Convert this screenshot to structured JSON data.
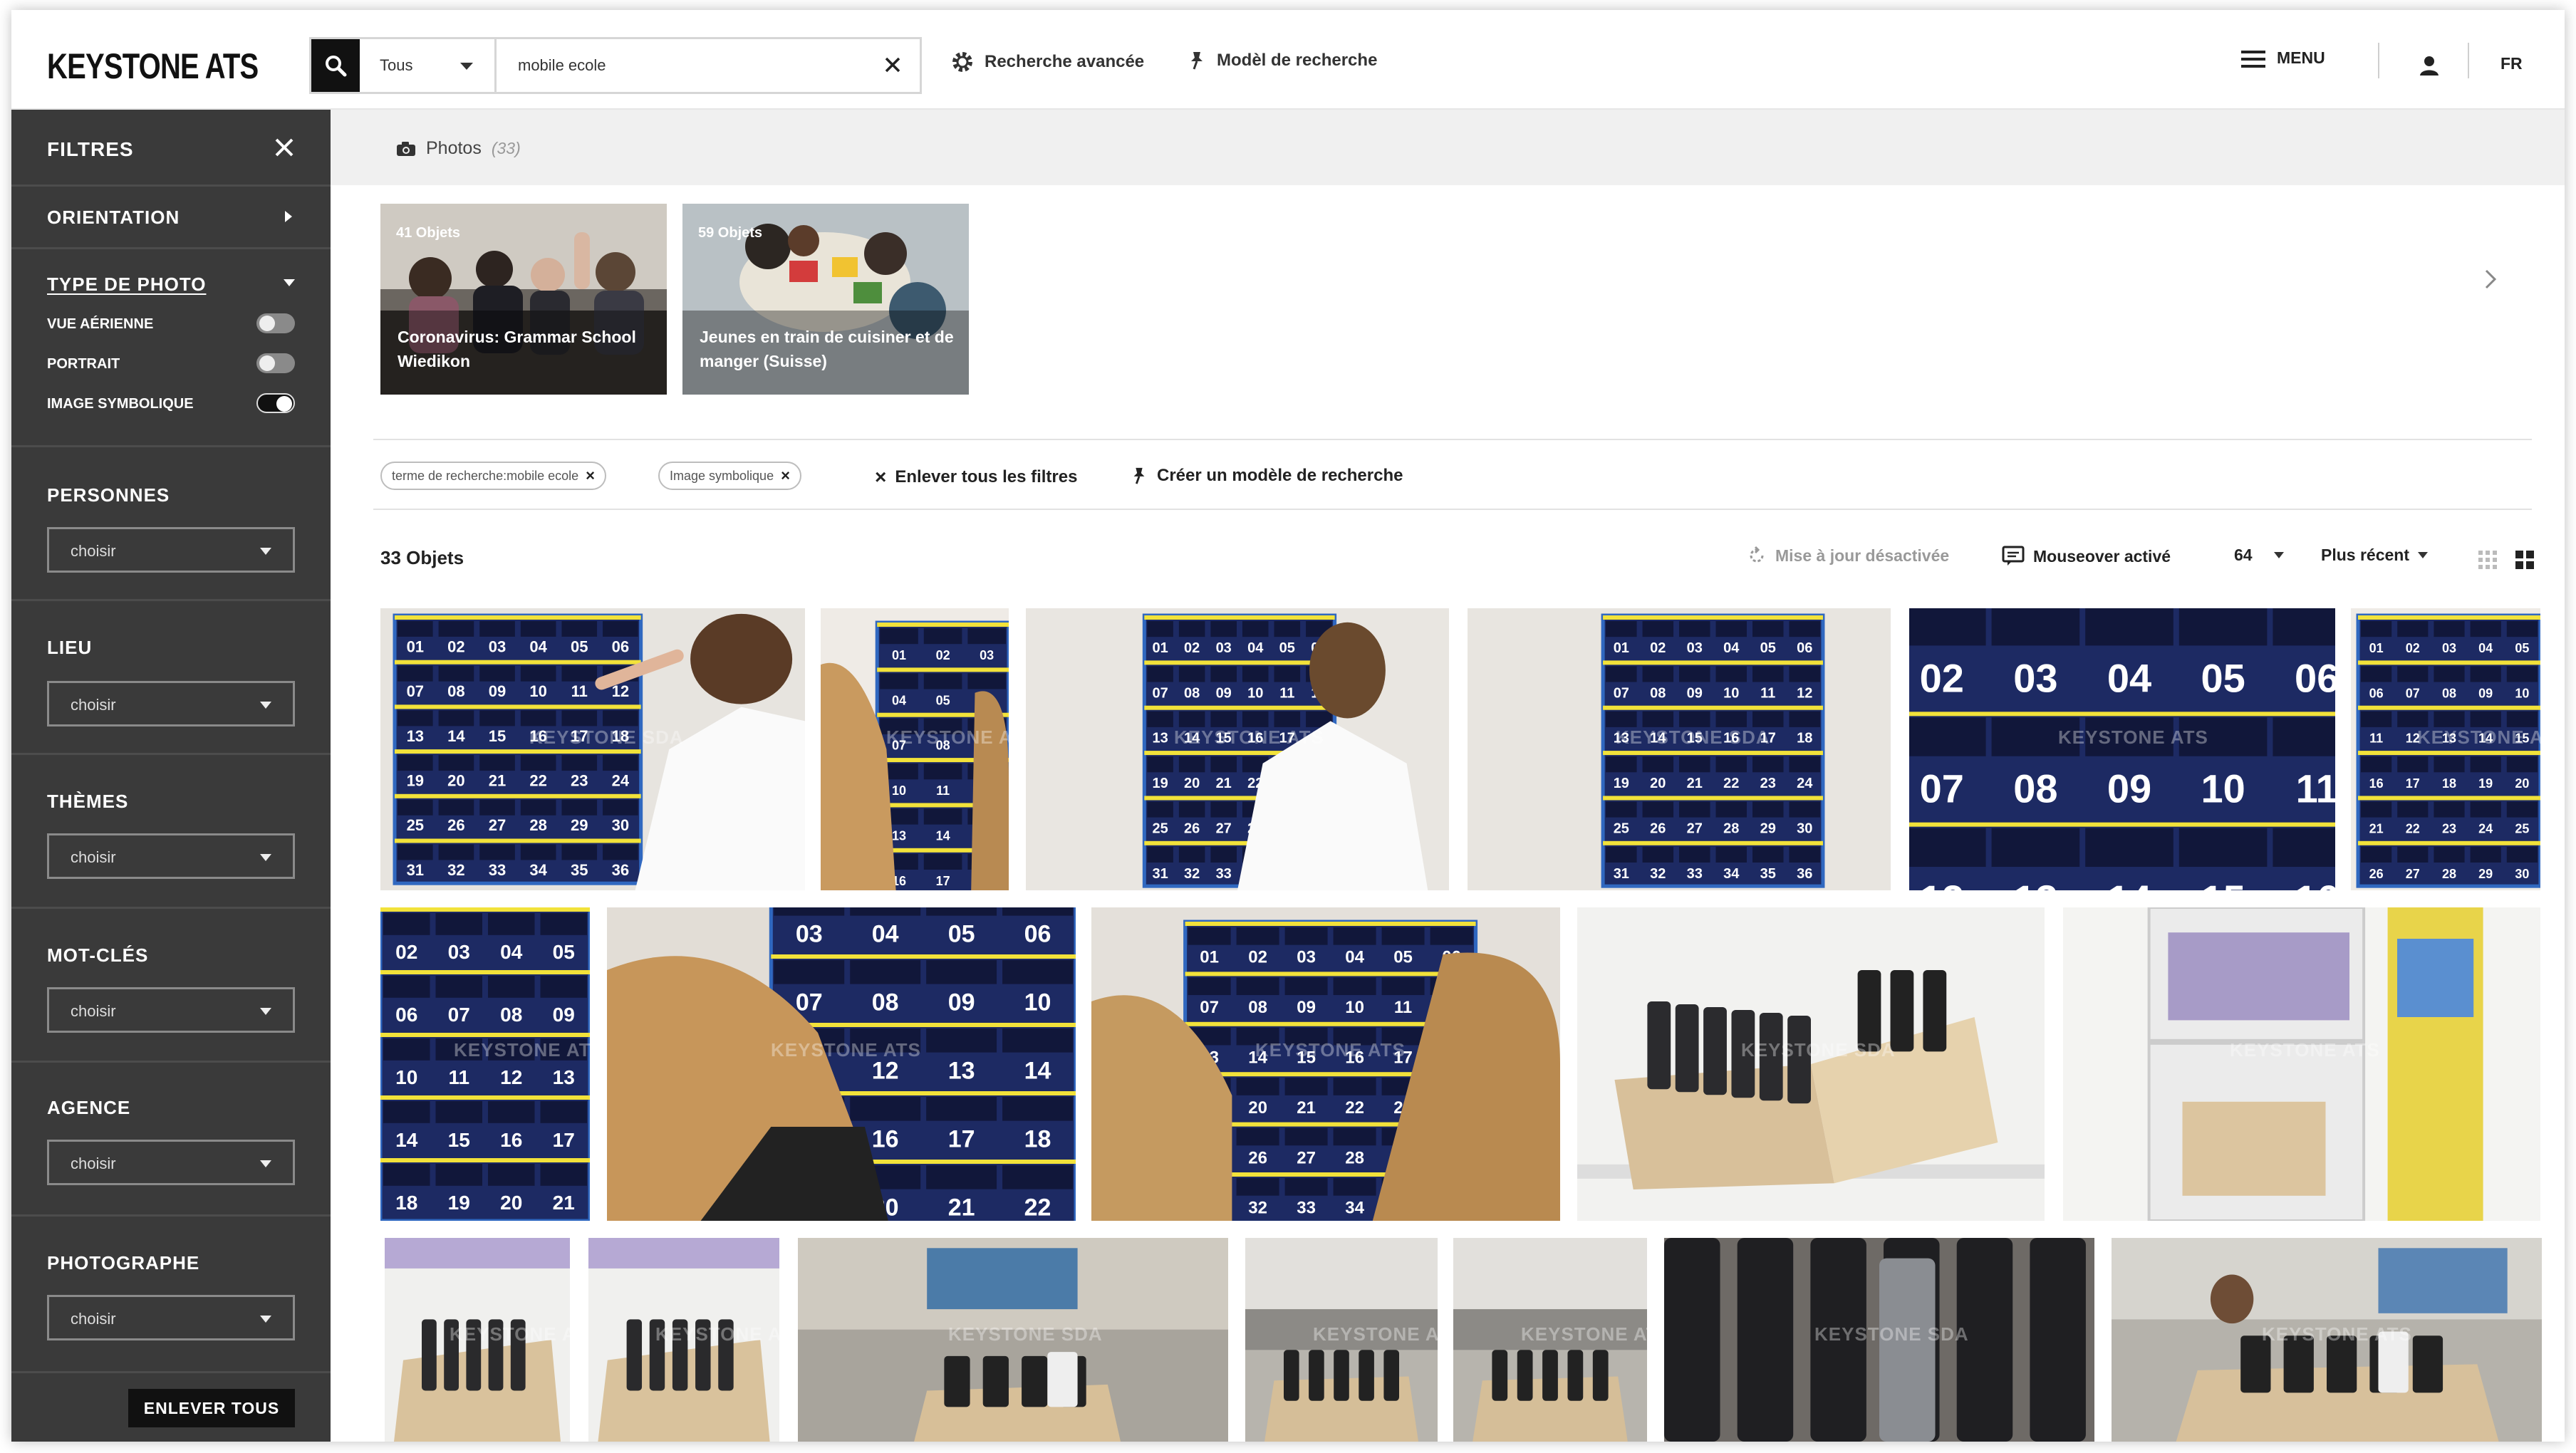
{
  "header": {
    "logo": "KEYSTONE ATS",
    "search_scope": "Tous",
    "search_query": "mobile ecole",
    "advanced_search": "Recherche avancée",
    "search_template": "Modèl de recherche",
    "menu": "MENU",
    "language": "FR"
  },
  "sidebar": {
    "title": "FILTRES",
    "orientation": "ORIENTATION",
    "photo_type": {
      "title": "TYPE DE PHOTO",
      "options": [
        {
          "label": "VUE AÉRIENNE",
          "on": false
        },
        {
          "label": "PORTRAIT",
          "on": false
        },
        {
          "label": "IMAGE SYMBOLIQUE",
          "on": true
        }
      ]
    },
    "sections": [
      {
        "title": "PERSONNES",
        "value": "choisir"
      },
      {
        "title": "LIEU",
        "value": "choisir"
      },
      {
        "title": "THÈMES",
        "value": "choisir"
      },
      {
        "title": "MOT-CLÉS",
        "value": "choisir"
      },
      {
        "title": "AGENCE",
        "value": "choisir"
      },
      {
        "title": "PHOTOGRAPHE",
        "value": "choisir"
      }
    ],
    "remove_all": "ENLEVER TOUS"
  },
  "main": {
    "photos_label": "Photos",
    "photos_count": "(33)",
    "stories": [
      {
        "count": "41 Objets",
        "caption": "Coronavirus: Grammar School Wiedikon"
      },
      {
        "count": "59 Objets",
        "caption": "Jeunes en train de cuisiner et de manger (Suisse)"
      }
    ],
    "chips": [
      "terme de recherche:mobile ecole",
      "Image symbolique"
    ],
    "remove_filters": "Enlever tous les filtres",
    "create_template": "Créer un modèle de recherche",
    "objects_count": "33 Objets",
    "update_status": "Mise à jour désactivée",
    "mouseover": "Mouseover activé",
    "per_page": "64",
    "sort": "Plus récent"
  },
  "colors": {
    "sidebar_bg": "#3a3a3a",
    "accent_dark": "#111111",
    "pocket_navy": "#1d2a63",
    "pocket_yellow": "#f2e23a"
  },
  "watermarks": [
    "KEYSTONE ATS",
    "KEYSTONE SDA"
  ],
  "icons": [
    "search-icon",
    "close-icon",
    "gear-icon",
    "pin-icon",
    "menu-icon",
    "user-icon",
    "camera-icon",
    "chevron-right-icon",
    "refresh-icon",
    "comment-icon",
    "grid-small-icon",
    "grid-large-icon"
  ]
}
